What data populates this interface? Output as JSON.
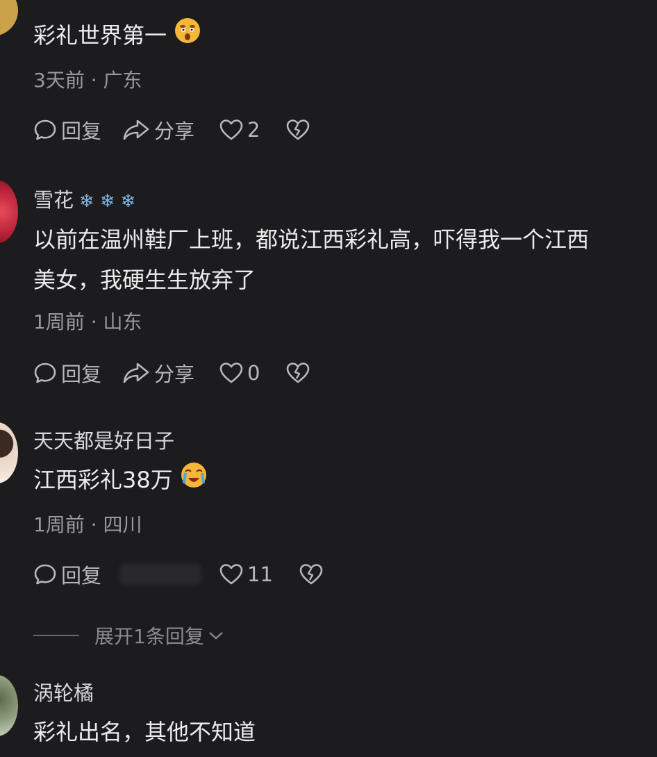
{
  "comments": [
    {
      "username": "",
      "text": "彩礼世界第一",
      "emoji_icon": "astonished-emoji-icon",
      "meta": "3天前 · 广东",
      "reply_label": "回复",
      "share_label": "分享",
      "like_count": "2"
    },
    {
      "username": "雪花",
      "username_decoration": [
        "❄",
        "❄",
        "❄"
      ],
      "text_lines": [
        "以前在温州鞋厂上班，都说江西彩礼高，吓得我一个江西",
        "美女，我硬生生放弃了"
      ],
      "meta": "1周前 · 山东",
      "reply_label": "回复",
      "share_label": "分享",
      "like_count": "0"
    },
    {
      "username": "天天都是好日子",
      "text": "江西彩礼38万",
      "emoji_icon": "loudly-crying-emoji-icon",
      "meta": "1周前 · 四川",
      "reply_label": "回复",
      "like_count": "11",
      "expand_label": "展开1条回复"
    },
    {
      "username": "涡轮橘",
      "text": "彩礼出名，其他不知道"
    }
  ],
  "colors": {
    "background": "#1c1c1e",
    "text": "#ececed",
    "meta": "#9a9a9c",
    "snowflake": "#7fb7e6",
    "emoji": "#f5b73a"
  }
}
